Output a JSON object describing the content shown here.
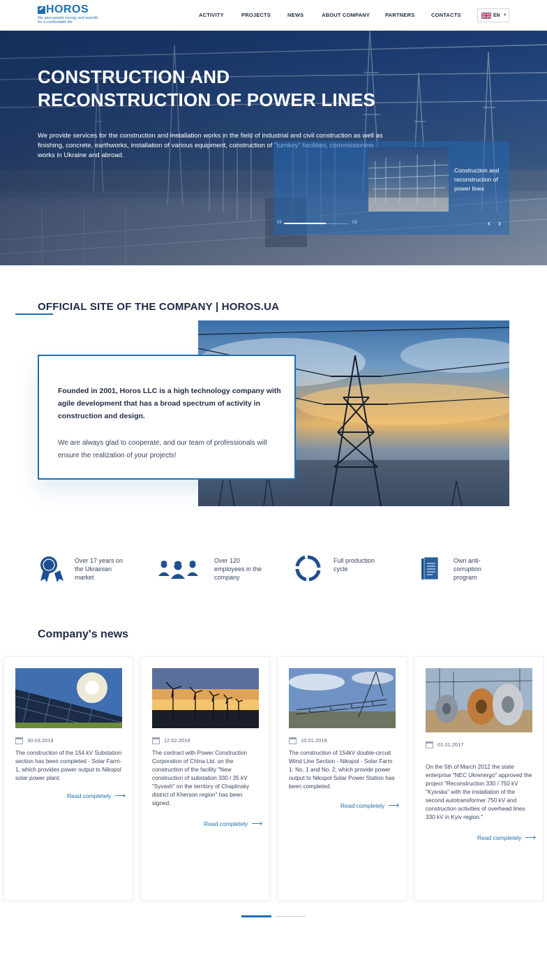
{
  "header": {
    "logo": {
      "brand": "HOROS",
      "tagline_line1": "We give people energy and warmth",
      "tagline_line2": "for a comfortable life"
    },
    "nav": [
      "ACTIVITY",
      "PROJECTS",
      "NEWS",
      "ABOUT COMPANY",
      "PARTNERS",
      "CONTACTS"
    ],
    "lang": {
      "value": "EN",
      "flag": "uk-flag-icon"
    }
  },
  "hero": {
    "title_line1": "CONSTRUCTION AND",
    "title_line2": "RECONSTRUCTION OF POWER LINES",
    "text": "We provide services for the construction and installation works in the field of industrial and civil construction as well as finishing, concrete, earthworks, installation of various equipment, construction of \"turnkey\" facilities, commissioning works in Ukraine and abroad.",
    "thumb_caption": "Construction and reconstruction of power lines",
    "slider": {
      "current": "03",
      "total": "03",
      "progress": 0.65
    },
    "prev_icon": "chevron-left-icon",
    "next_icon": "chevron-right-icon"
  },
  "about": {
    "section_title": "OFFICIAL SITE OF THE COMPANY | HOROS.UA",
    "strong_text": "Founded in 2001, Horos LLC is a high technology company with agile development that has a broad spectrum of activity in construction and design.",
    "text": "We are always glad to cooperate, and our team of professionals will ensure the realization of your projects!"
  },
  "features": [
    {
      "icon": "medal-icon",
      "text": "Over 17 years on the Ukrainian market"
    },
    {
      "icon": "workers-icon",
      "text": "Over 120 employees in the company"
    },
    {
      "icon": "cycle-icon",
      "text": "Full production cycle"
    },
    {
      "icon": "document-icon",
      "text": "Own anti-corruption program"
    }
  ],
  "news": {
    "title": "Company's news",
    "read_more": "Read completely",
    "items": [
      {
        "date": "30.03.2019",
        "text": "The construction of the 154 kV Substation section has been completed - Solar Farm-1, which provides power output to Nikopol solar power plant."
      },
      {
        "date": "12.02.2019",
        "text": "The contract with Power Construction Corporation of China Ltd. on the construction of the facility \"New construction of substation 330 / 35 kV \"Syvash\" on the territory of Chaplinsky district of Kherson region\" has been signed."
      },
      {
        "date": "10.01.2019",
        "text": "The construction of 154kV double-circuit Wind Line Section - Nikopol - Solar Farm 1: No. 1 and No. 2, which provide power output to Nikopol Solar Power Station has been completed."
      },
      {
        "date": "01.01.2017",
        "text": "On the 5th of March 2012 the state enterprise \"NEC Ukrenergo\" approved the project \"Reconstruction 330 / 750 kV \"Kyivska\" with the installation of the second autotransformer 750 kV and construction activities of overhead lines 330 kV in Kyiv region.\""
      }
    ]
  },
  "colors": {
    "accent": "#1f6fb2",
    "heading": "#1f2a44",
    "text": "#38445c"
  }
}
